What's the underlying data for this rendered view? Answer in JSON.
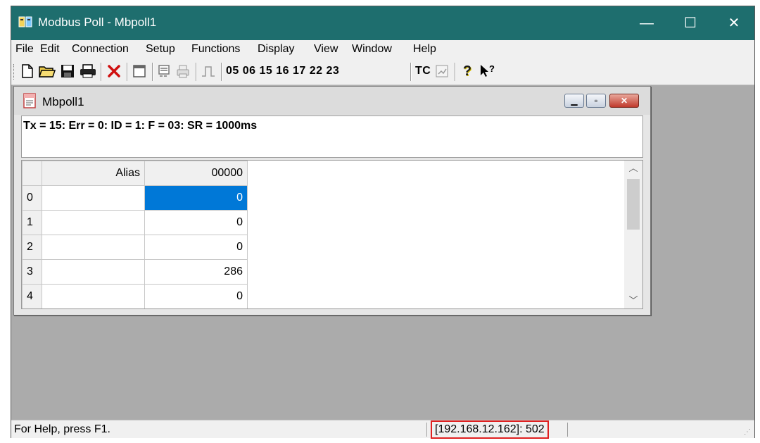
{
  "window": {
    "title": "Modbus Poll - Mbpoll1",
    "app_icon": "modbus-poll-icon",
    "buttons": {
      "minimize": "—",
      "maximize": "☐",
      "close": "✕"
    },
    "titlebar_color": "#1e6e6e"
  },
  "menu": [
    {
      "label": "File"
    },
    {
      "label": "Edit"
    },
    {
      "label": "Connection"
    },
    {
      "label": "Setup"
    },
    {
      "label": "Functions"
    },
    {
      "label": "Display"
    },
    {
      "label": "View"
    },
    {
      "label": "Window"
    },
    {
      "label": "Help"
    }
  ],
  "toolbar": {
    "icons": [
      "new-file-icon",
      "open-folder-icon",
      "save-icon",
      "print-icon",
      "delete-icon",
      "window-icon",
      "read-write-icon",
      "print-preview-icon",
      "pulse-icon",
      "test-center-icon",
      "help-icon",
      "context-help-icon"
    ],
    "function_codes": "05 06 15 16 17 22 23",
    "tc_label": "TC"
  },
  "child": {
    "title": "Mbpoll1",
    "status_line": "Tx = 15: Err = 0: ID = 1: F = 03: SR = 1000ms",
    "grid": {
      "headers": {
        "alias": "Alias",
        "address": "00000"
      },
      "rows": [
        {
          "index": "0",
          "alias": "",
          "value": "0",
          "selected": true
        },
        {
          "index": "1",
          "alias": "",
          "value": "0"
        },
        {
          "index": "2",
          "alias": "",
          "value": "0"
        },
        {
          "index": "3",
          "alias": "",
          "value": "286"
        },
        {
          "index": "4",
          "alias": "",
          "value": "0"
        }
      ]
    }
  },
  "statusbar": {
    "help_text": "For Help, press F1.",
    "connection": "[192.168.12.162]: 502",
    "highlight_color": "#e02020"
  }
}
